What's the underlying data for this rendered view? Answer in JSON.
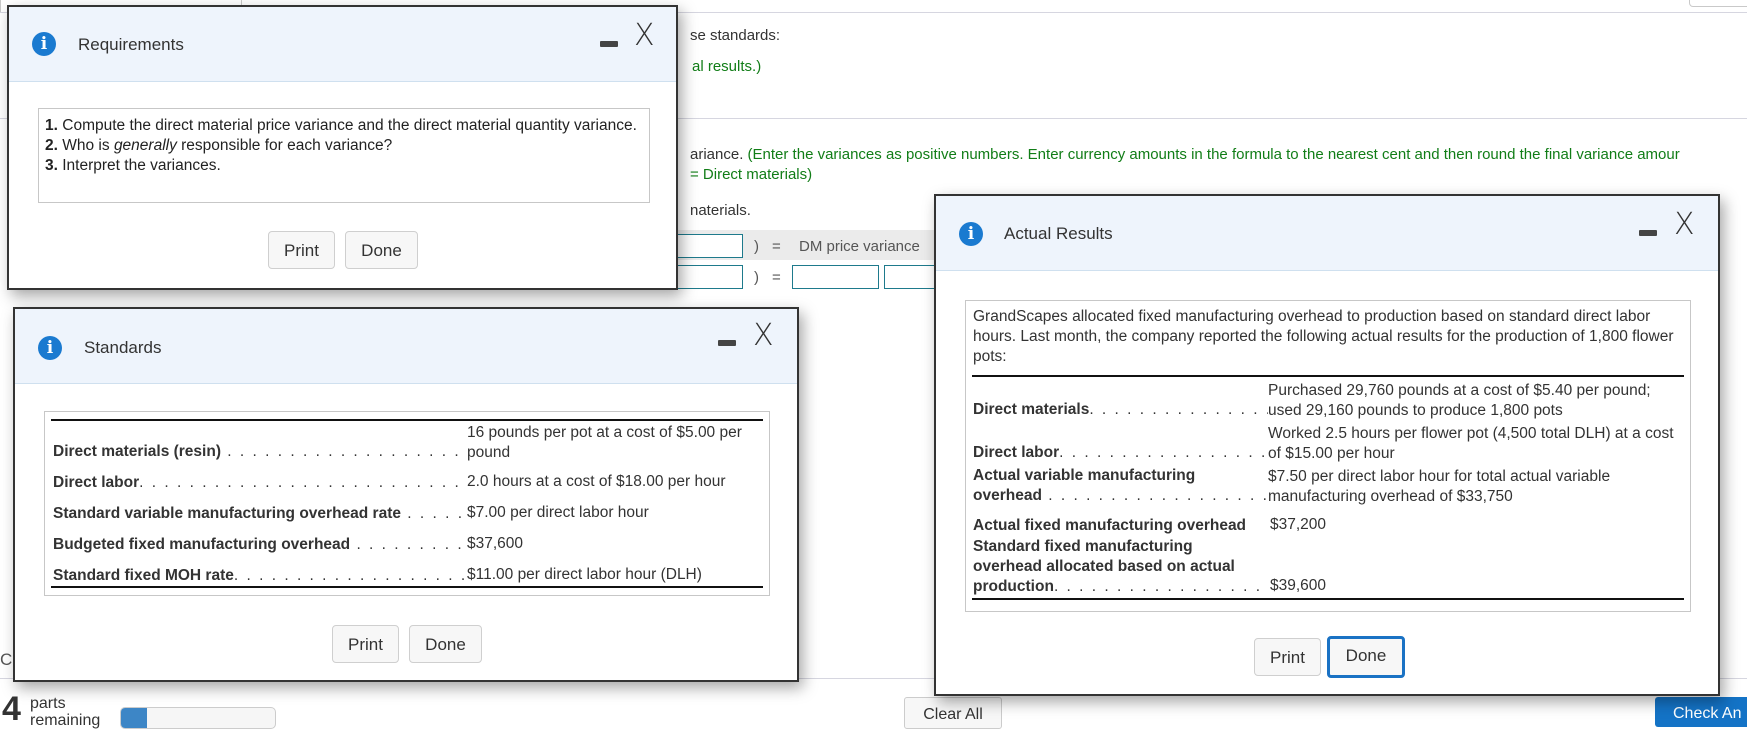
{
  "background": {
    "line1_fragment": "se standards:",
    "line2_fragment": "al results.)",
    "instruction_fragment_1": "ariance. ",
    "instruction_green_1": "(Enter the variances as positive numbers. Enter currency amounts in the formula to the nearest cent and then round the final variance amour",
    "instruction_green_2": "= Direct materials)",
    "materials_fragment": "naterials.",
    "formula": {
      "row1_paren": ")",
      "row1_eq": "=",
      "row1_label": "DM price variance",
      "row2_paren": ")",
      "row2_eq": "="
    },
    "left_fragment": "C",
    "parts_remaining_count": "4",
    "parts_label": "parts",
    "parts_label2": "remaining",
    "progress_fraction": 0.17,
    "clear_all_label": "Clear All",
    "check_answer_label": "Check An"
  },
  "dialogs": {
    "requirements": {
      "title": "Requirements",
      "items": [
        {
          "num": "1.",
          "text": "Compute the direct material price variance and the direct material quantity variance."
        },
        {
          "num": "2.",
          "text_before": "Who is ",
          "text_em": "generally",
          "text_after": " responsible for each variance?"
        },
        {
          "num": "3.",
          "text": "Interpret the variances."
        }
      ],
      "print_label": "Print",
      "done_label": "Done"
    },
    "standards": {
      "title": "Standards",
      "rows": [
        {
          "label": "Direct materials (resin)",
          "dots": " . . . . . . . . . . . . . . . . . . . . . . . . . .",
          "value": "16 pounds per pot at a cost of $5.00 per pound"
        },
        {
          "label": "Direct labor",
          "dots": ". . . . . . . . . . . . . . . . . . . . . . . . . . . . . . . . . . .",
          "value": "2.0 hours at a cost of $18.00 per hour"
        },
        {
          "label": "Standard variable manufacturing overhead rate",
          "dots": " . . . . .",
          "value": "$7.00 per direct labor hour"
        },
        {
          "label": "Budgeted fixed manufacturing overhead",
          "dots": " . . . . . . . . . . .",
          "value": "$37,600"
        },
        {
          "label": "Standard fixed MOH rate",
          "dots": ". . . . . . . . . . . . . . . . . . . . . . . .",
          "value": "$11.00 per direct labor hour (DLH)"
        }
      ],
      "print_label": "Print",
      "done_label": "Done"
    },
    "actual_results": {
      "title": "Actual Results",
      "intro": "GrandScapes allocated fixed manufacturing overhead to production based on standard direct labor hours. Last month, the company reported the following actual results for the production of 1,800 flower pots:",
      "rows": [
        {
          "label": "Direct materials",
          "dots": ". . . . . . . . . . . . . . . . . . .",
          "value": "Purchased 29,760 pounds at a cost of $5.40 per pound; used 29,160 pounds to produce 1,800 pots"
        },
        {
          "label": "Direct labor",
          "dots": ". . . . . . . . . . . . . . . . . . . . . . .",
          "value": "Worked 2.5 hours per flower pot (4,500 total DLH) at a cost of $15.00 per hour"
        },
        {
          "label_line1": "Actual variable manufacturing",
          "label": "overhead",
          "dots": " . . . . . . . . . . . . . . . . . . . . . . .",
          "value": "$7.50 per direct labor hour for total actual variable manufacturing overhead of $33,750"
        },
        {
          "label": "Actual fixed manufacturing overhead",
          "dots": "",
          "value": "$37,200"
        },
        {
          "label_line1": "Standard fixed manufacturing",
          "label_line2": "overhead allocated based on actual",
          "label": "production",
          "dots": ". . . . . . . . . . . . . . . . . . . . . .",
          "value": "$39,600"
        }
      ],
      "print_label": "Print",
      "done_label": "Done"
    }
  },
  "icons": {
    "info": "i",
    "close": "X"
  }
}
